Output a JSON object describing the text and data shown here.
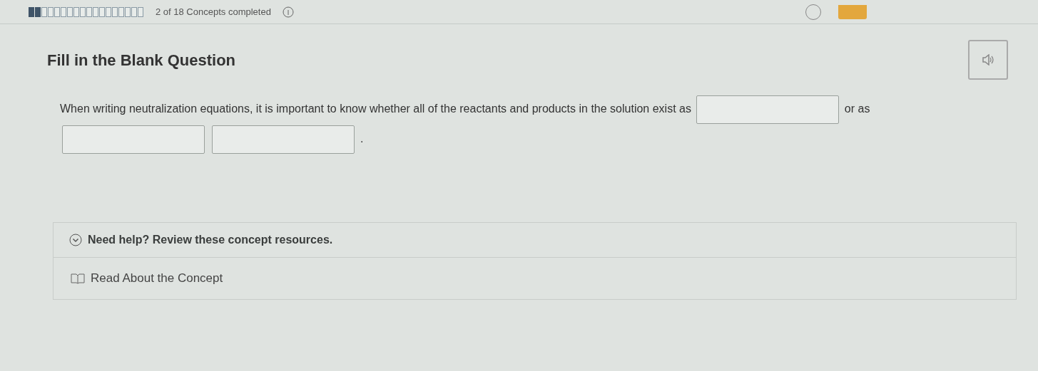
{
  "progress": {
    "level": 0.111,
    "text": "2 of 18 Concepts completed"
  },
  "question": {
    "title": "Fill in the Blank Question",
    "parts": [
      {
        "kind": "text",
        "text": "When writing neutralization equations, it is important to know whether all of the reactants and products in the solution exist as"
      },
      {
        "kind": "blank"
      },
      {
        "kind": "text",
        "text": "or as"
      },
      {
        "kind": "blank"
      },
      {
        "kind": "blank"
      },
      {
        "kind": "text",
        "text": "."
      }
    ]
  },
  "help": {
    "title": "Need help? Review these concept resources.",
    "expanded": true,
    "resources": [
      {
        "label": "Read About the Concept"
      }
    ]
  }
}
